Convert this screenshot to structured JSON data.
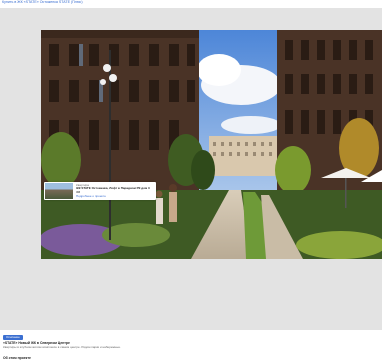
{
  "breadcrumb": "Купить в ЖК «STATE» Остоженка STATE (Плюс)",
  "overlay": {
    "tag": "Квартира",
    "title": "ЖК STATE Остоженка, Лофт в Парадном РК дом 3",
    "price": "3М",
    "link": "Подробнее о проекте"
  },
  "footer": {
    "badge": "Описание",
    "title": "«STATE» Новый ЖК в Северном Центре",
    "description": "Квартиры в клубном жилом комплексе в самом центре. Рядом парки и набережные.",
    "section": "Об этом проекте"
  },
  "colors": {
    "accent": "#3b6fd1",
    "gallery_bg": "#e3e3e3"
  }
}
